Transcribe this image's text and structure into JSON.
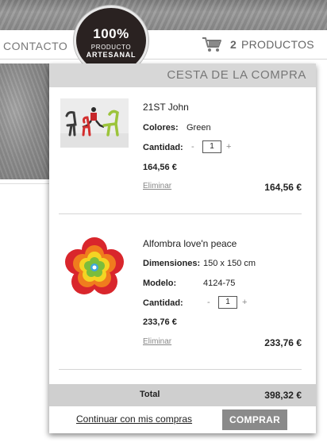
{
  "header": {
    "nav_link": "CONTACTO",
    "cart_count": "2",
    "cart_word": "PRODUCTOS"
  },
  "badge": {
    "percent": "100%",
    "line1": "PRODUCTO",
    "line2": "ARTESANAL"
  },
  "cart": {
    "title": "CESTA DE LA COMPRA",
    "items": [
      {
        "name": "21ST John",
        "image_icon": "chairs-photo",
        "attributes": [
          {
            "label": "Colores:",
            "value": "Green"
          }
        ],
        "quantity_label": "Cantidad:",
        "quantity": "1",
        "minus": "-",
        "plus": "+",
        "unit_price": "164,56 €",
        "remove_label": "Eliminar",
        "line_total": "164,56 €"
      },
      {
        "name": "Alfombra love'n peace",
        "image_icon": "flower-rug-photo",
        "attributes": [
          {
            "label": "Dimensiones:",
            "value": "150 x 150 cm"
          },
          {
            "label": "Modelo:",
            "value": "4124-75"
          }
        ],
        "quantity_label": "Cantidad:",
        "quantity": "1",
        "minus": "-",
        "plus": "+",
        "unit_price": "233,76 €",
        "remove_label": "Eliminar",
        "line_total": "233,76 €"
      }
    ],
    "total_label": "Total",
    "total_value": "398,32 €",
    "continue_label": "Continuar con mis compras",
    "buy_label": "COMPRAR"
  },
  "colors": {
    "panel_header": "#d7d7d7",
    "total_bar": "#cfcfcf",
    "buy_button": "#8a8a8a",
    "badge_bg": "#2a2221"
  }
}
